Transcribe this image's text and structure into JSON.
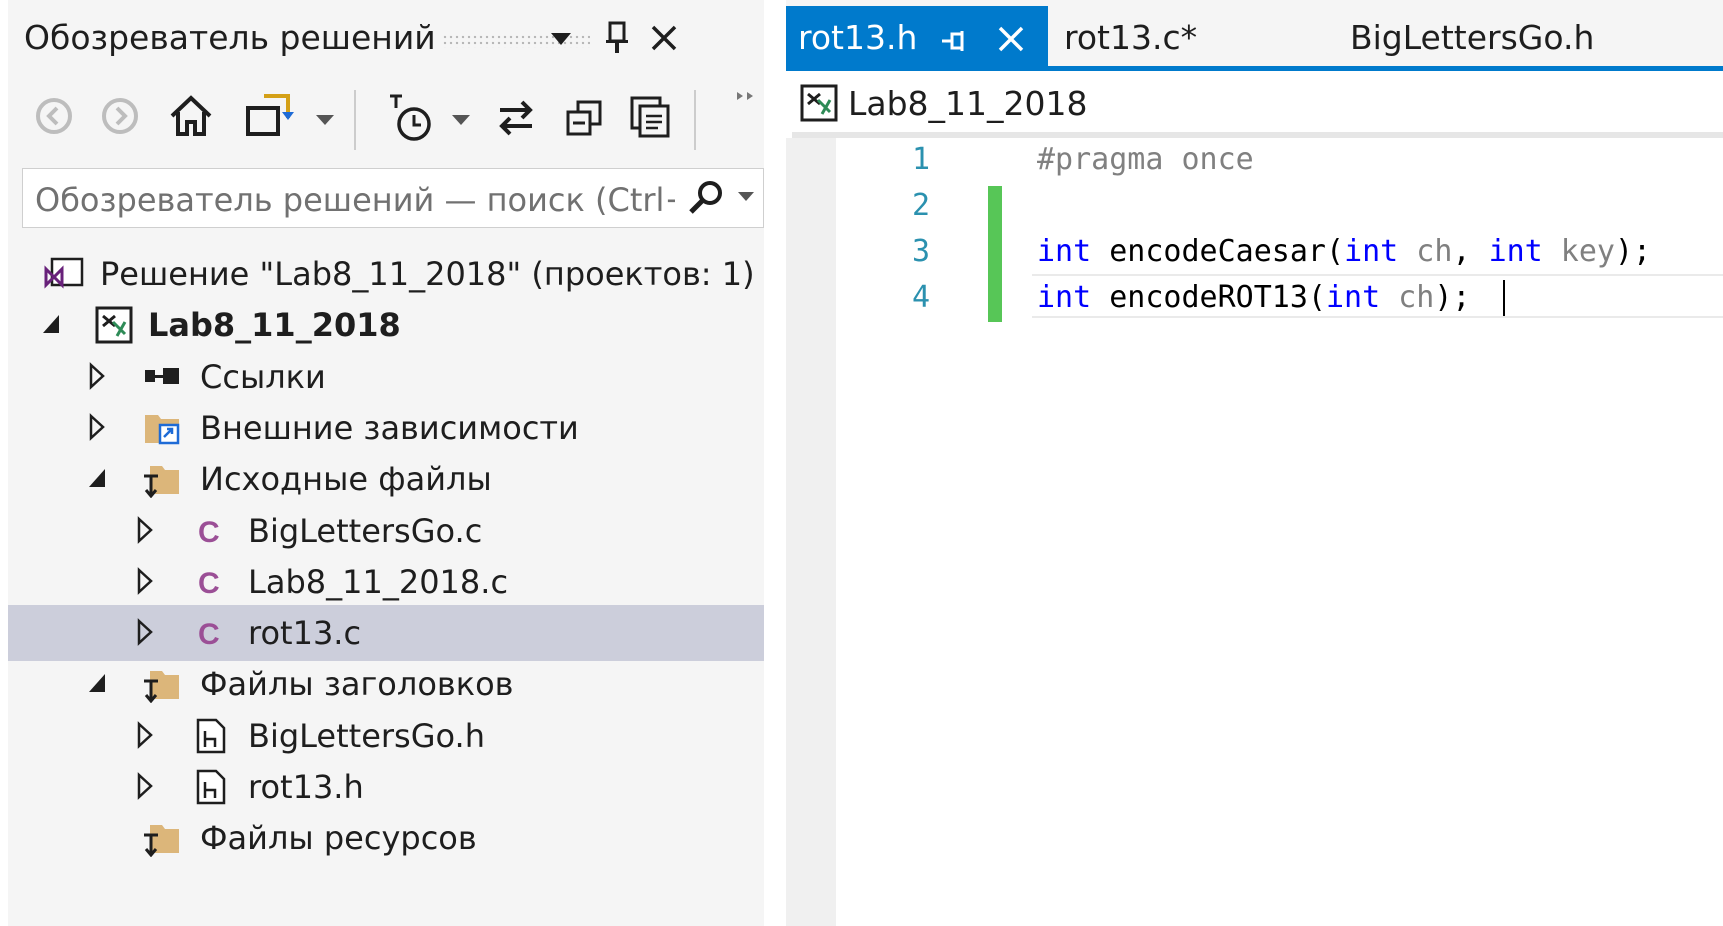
{
  "solution_explorer": {
    "title": "Обозреватель решений",
    "search_placeholder": "Обозреватель решений — поиск (Ctrl+;)",
    "toolbar_icons": [
      "back-icon",
      "forward-icon",
      "home-icon",
      "sync-icon",
      "history-icon",
      "swap-icon",
      "collapse-icon",
      "copy-icon",
      "more-icon"
    ],
    "tree": [
      {
        "label": "Решение \"Lab8_11_2018\"  (проектов: 1)",
        "icon": "solution-icon",
        "level": 0,
        "expander": "none",
        "bold": false,
        "selected": false
      },
      {
        "label": "Lab8_11_2018",
        "icon": "project-icon",
        "level": 1,
        "expander": "expanded",
        "bold": true,
        "selected": false
      },
      {
        "label": "Ссылки",
        "icon": "references-icon",
        "level": 2,
        "expander": "collapsed",
        "bold": false,
        "selected": false
      },
      {
        "label": "Внешние зависимости",
        "icon": "external-deps-icon",
        "level": 2,
        "expander": "collapsed",
        "bold": false,
        "selected": false
      },
      {
        "label": "Исходные файлы",
        "icon": "folder-icon",
        "level": 2,
        "expander": "expanded",
        "bold": false,
        "selected": false
      },
      {
        "label": "BigLettersGo.c",
        "icon": "c-file-icon",
        "level": 3,
        "expander": "collapsed",
        "bold": false,
        "selected": false
      },
      {
        "label": "Lab8_11_2018.c",
        "icon": "c-file-icon",
        "level": 3,
        "expander": "collapsed",
        "bold": false,
        "selected": false
      },
      {
        "label": "rot13.c",
        "icon": "c-file-icon",
        "level": 3,
        "expander": "collapsed",
        "bold": false,
        "selected": true
      },
      {
        "label": "Файлы заголовков",
        "icon": "folder-icon",
        "level": 2,
        "expander": "expanded",
        "bold": false,
        "selected": false
      },
      {
        "label": "BigLettersGo.h",
        "icon": "h-file-icon",
        "level": 3,
        "expander": "collapsed",
        "bold": false,
        "selected": false
      },
      {
        "label": "rot13.h",
        "icon": "h-file-icon",
        "level": 3,
        "expander": "collapsed",
        "bold": false,
        "selected": false
      },
      {
        "label": "Файлы ресурсов",
        "icon": "folder-icon",
        "level": 2,
        "expander": "none",
        "bold": false,
        "selected": false
      }
    ]
  },
  "editor": {
    "tabs": [
      {
        "label": "rot13.h",
        "active": true
      },
      {
        "label": "rot13.c*",
        "active": false
      },
      {
        "label": "BigLettersGo.h",
        "active": false
      }
    ],
    "nav_project": "Lab8_11_2018",
    "line_numbers": [
      "1",
      "2",
      "3",
      "4"
    ],
    "code": {
      "line1": {
        "pp": "#pragma once"
      },
      "line3": {
        "kw1": "int",
        "t1": " encodeCaesar(",
        "kw2": "int",
        "p1": " ch",
        "t2": ", ",
        "kw3": "int",
        "p2": " key",
        "t3": ");"
      },
      "line4": {
        "kw1": "int",
        "t1": " encodeROT13(",
        "kw2": "int",
        "p1": " ch",
        "t2": ");"
      }
    }
  },
  "colors": {
    "accent": "#007acc",
    "selection": "#cccedb",
    "change_bar": "#57c657",
    "keyword": "#0000ff",
    "line_number": "#2b91af"
  }
}
